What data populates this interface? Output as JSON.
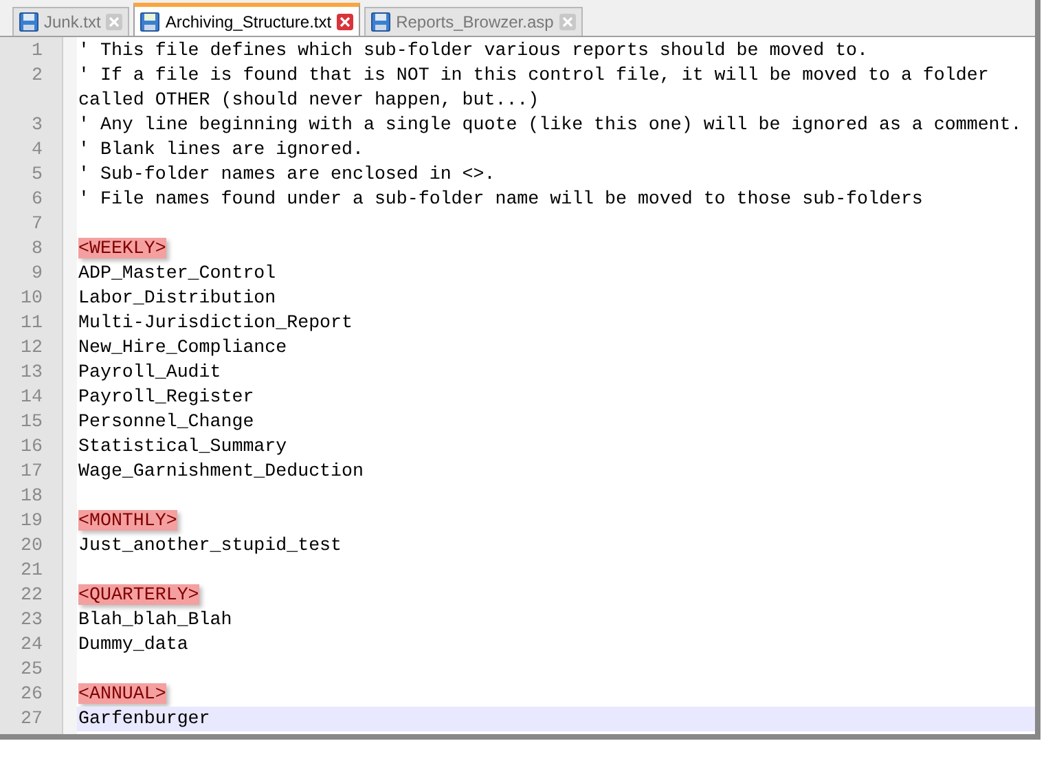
{
  "tabs": [
    {
      "label": "Junk.txt",
      "selected": false
    },
    {
      "label": "Archiving_Structure.txt",
      "selected": true
    },
    {
      "label": "Reports_Browzer.asp",
      "selected": false
    }
  ],
  "editor": {
    "lines": [
      {
        "number": "1",
        "text": "' This file defines which sub-folder various reports should be moved to.",
        "kind": "comment",
        "selected": false
      },
      {
        "number": "2",
        "text": "' If a file is found that is NOT in this control file, it will be moved to a folder called OTHER (should never happen, but...)",
        "kind": "comment",
        "selected": false
      },
      {
        "number": "3",
        "text": "' Any line beginning with a single quote (like this one) will be ignored as a comment.",
        "kind": "comment",
        "selected": false
      },
      {
        "number": "4",
        "text": "' Blank lines are ignored.",
        "kind": "comment",
        "selected": false
      },
      {
        "number": "5",
        "text": "' Sub-folder names are enclosed in <>.",
        "kind": "comment",
        "selected": false
      },
      {
        "number": "6",
        "text": "' File names found under a sub-folder name will be moved to those sub-folders",
        "kind": "comment",
        "selected": false
      },
      {
        "number": "7",
        "kind": "blank",
        "selected": false
      },
      {
        "number": "8",
        "text": "<WEEKLY>",
        "kind": "tag",
        "selected": false
      },
      {
        "number": "9",
        "text": "ADP_Master_Control",
        "kind": "plain",
        "selected": false
      },
      {
        "number": "10",
        "text": "Labor_Distribution",
        "kind": "plain",
        "selected": false
      },
      {
        "number": "11",
        "text": "Multi-Jurisdiction_Report",
        "kind": "plain",
        "selected": false
      },
      {
        "number": "12",
        "text": "New_Hire_Compliance",
        "kind": "plain",
        "selected": false
      },
      {
        "number": "13",
        "text": "Payroll_Audit",
        "kind": "plain",
        "selected": false
      },
      {
        "number": "14",
        "text": "Payroll_Register",
        "kind": "plain",
        "selected": false
      },
      {
        "number": "15",
        "text": "Personnel_Change",
        "kind": "plain",
        "selected": false
      },
      {
        "number": "16",
        "text": "Statistical_Summary",
        "kind": "plain",
        "selected": false
      },
      {
        "number": "17",
        "text": "Wage_Garnishment_Deduction",
        "kind": "plain",
        "selected": false
      },
      {
        "number": "18",
        "kind": "blank",
        "selected": false
      },
      {
        "number": "19",
        "text": "<MONTHLY>",
        "kind": "tag",
        "selected": false
      },
      {
        "number": "20",
        "text": "Just_another_stupid_test",
        "kind": "plain",
        "selected": false
      },
      {
        "number": "21",
        "kind": "blank",
        "selected": false
      },
      {
        "number": "22",
        "text": "<QUARTERLY>",
        "kind": "tag",
        "selected": false
      },
      {
        "number": "23",
        "text": "Blah_blah_Blah",
        "kind": "plain",
        "selected": false
      },
      {
        "number": "24",
        "text": "Dummy_data",
        "kind": "plain",
        "selected": false
      },
      {
        "number": "25",
        "kind": "blank",
        "selected": false
      },
      {
        "number": "26",
        "text": "<ANNUAL>",
        "kind": "tag",
        "selected": false
      },
      {
        "number": "27",
        "text": "Garfenburger",
        "kind": "plain",
        "selected": true
      }
    ]
  }
}
